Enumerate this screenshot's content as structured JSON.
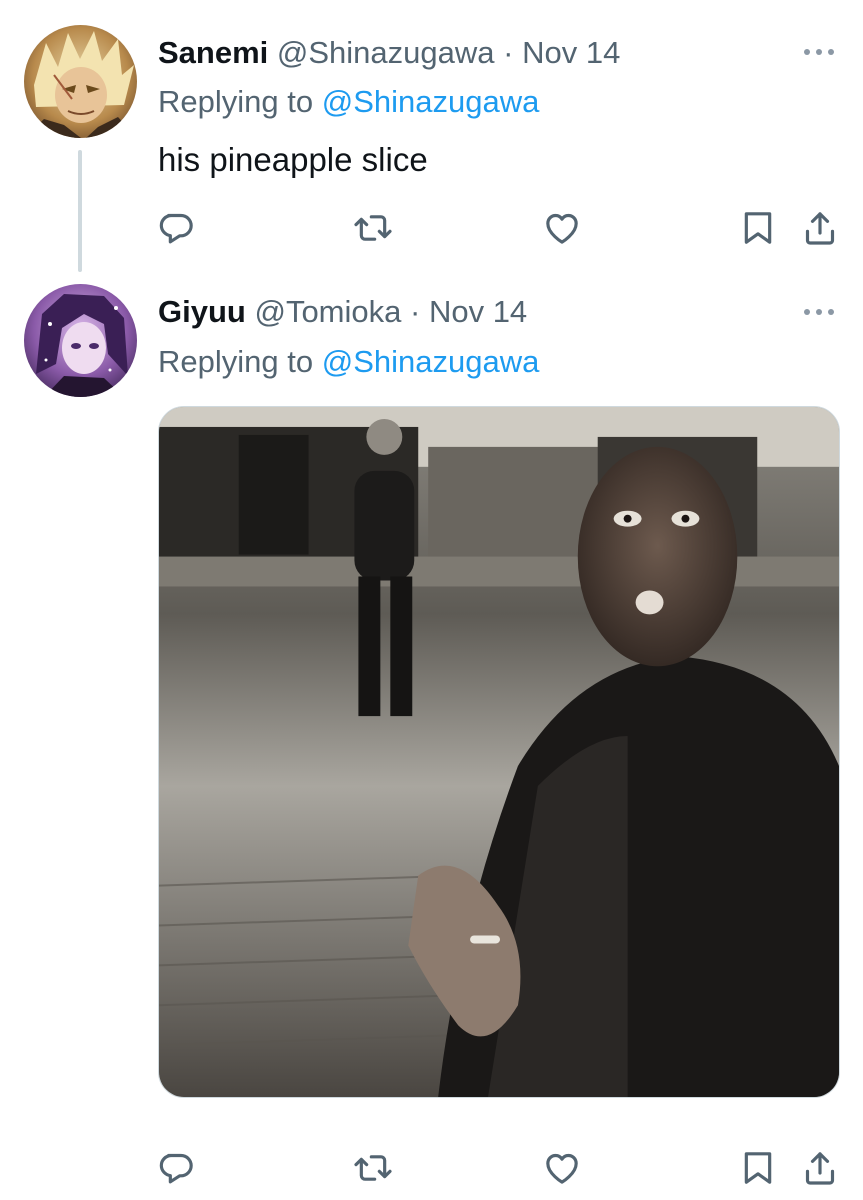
{
  "colors": {
    "text_primary": "#0f1419",
    "text_secondary": "#536471",
    "link": "#1d9bf0",
    "icon": "#536471",
    "thread_line": "#cfd9de"
  },
  "tweets": [
    {
      "display_name": "Sanemi",
      "handle": "@Shinazugawa",
      "separator": "·",
      "date": "Nov 14",
      "replying_prefix": "Replying to",
      "replying_to": "@Shinazugawa",
      "text": "his pineapple slice",
      "avatar_icon": "anime-character-avatar-blond",
      "actions": [
        "reply-icon",
        "retweet-icon",
        "like-icon",
        "bookmark-icon",
        "share-icon"
      ]
    },
    {
      "display_name": "Giyuu",
      "handle": "@Tomioka",
      "separator": "·",
      "date": "Nov 14",
      "replying_prefix": "Replying to",
      "replying_to": "@Shinazugawa",
      "media": "reaction-gif-woman-street-night",
      "avatar_icon": "anime-character-avatar-purple",
      "actions": [
        "reply-icon",
        "retweet-icon",
        "like-icon",
        "bookmark-icon",
        "share-icon"
      ]
    }
  ]
}
